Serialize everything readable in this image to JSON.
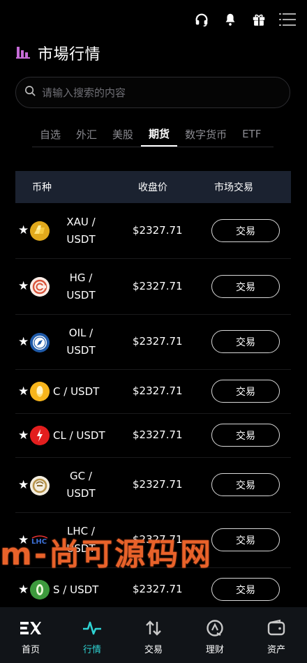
{
  "header": {
    "title": "市場行情",
    "icons": [
      "headset-icon",
      "bell-icon",
      "gift-icon",
      "menu-icon"
    ]
  },
  "search": {
    "placeholder": "请输入搜索的内容",
    "value": ""
  },
  "tabs": [
    {
      "label": "自选",
      "active": false
    },
    {
      "label": "外汇",
      "active": false
    },
    {
      "label": "美股",
      "active": false
    },
    {
      "label": "期货",
      "active": true
    },
    {
      "label": "数字货币",
      "active": false
    },
    {
      "label": "ETF",
      "active": false
    }
  ],
  "table": {
    "headers": {
      "currency": "币种",
      "close_price": "收盘价",
      "market_trade": "市场交易"
    },
    "rows": [
      {
        "symbol_line1": "XAU /",
        "symbol_line2": "USDT",
        "price": "$2327.71",
        "action": "交易",
        "icon": "gold-bars-icon"
      },
      {
        "symbol_line1": "HG /",
        "symbol_line2": "USDT",
        "price": "$2327.71",
        "action": "交易",
        "icon": "copper-icon"
      },
      {
        "symbol_line1": "OIL /",
        "symbol_line2": "USDT",
        "price": "$2327.71",
        "action": "交易",
        "icon": "oil-compass-icon"
      },
      {
        "symbol": "C / USDT",
        "price": "$2327.71",
        "action": "交易",
        "icon": "corn-icon"
      },
      {
        "symbol": "CL / USDT",
        "price": "$2327.71",
        "action": "交易",
        "icon": "crude-oil-flame-icon"
      },
      {
        "symbol_line1": "GC /",
        "symbol_line2": "USDT",
        "price": "$2327.71",
        "action": "交易",
        "icon": "gold-coin-icon"
      },
      {
        "symbol_line1": "LHC /",
        "symbol_line2": "USDT",
        "price": "$2327.71",
        "action": "交易",
        "icon": "lhc-logo-icon"
      },
      {
        "symbol": "S / USDT",
        "price": "$2327.71",
        "action": "交易",
        "icon": "soybean-icon"
      }
    ]
  },
  "watermark": "m-尚可源码网",
  "bottom_nav": [
    {
      "label": "首页",
      "icon": "ex-logo-icon",
      "active": false
    },
    {
      "label": "行情",
      "icon": "pulse-icon",
      "active": true
    },
    {
      "label": "交易",
      "icon": "swap-arrows-icon",
      "active": false
    },
    {
      "label": "理财",
      "icon": "at-sign-icon",
      "active": false
    },
    {
      "label": "资产",
      "icon": "wallet-icon",
      "active": false
    }
  ],
  "colors": {
    "accent": "#2fd4d4",
    "title_icon": "#c56bd6",
    "table_header_bg": "#1b2230",
    "watermark": "#e8622a"
  }
}
